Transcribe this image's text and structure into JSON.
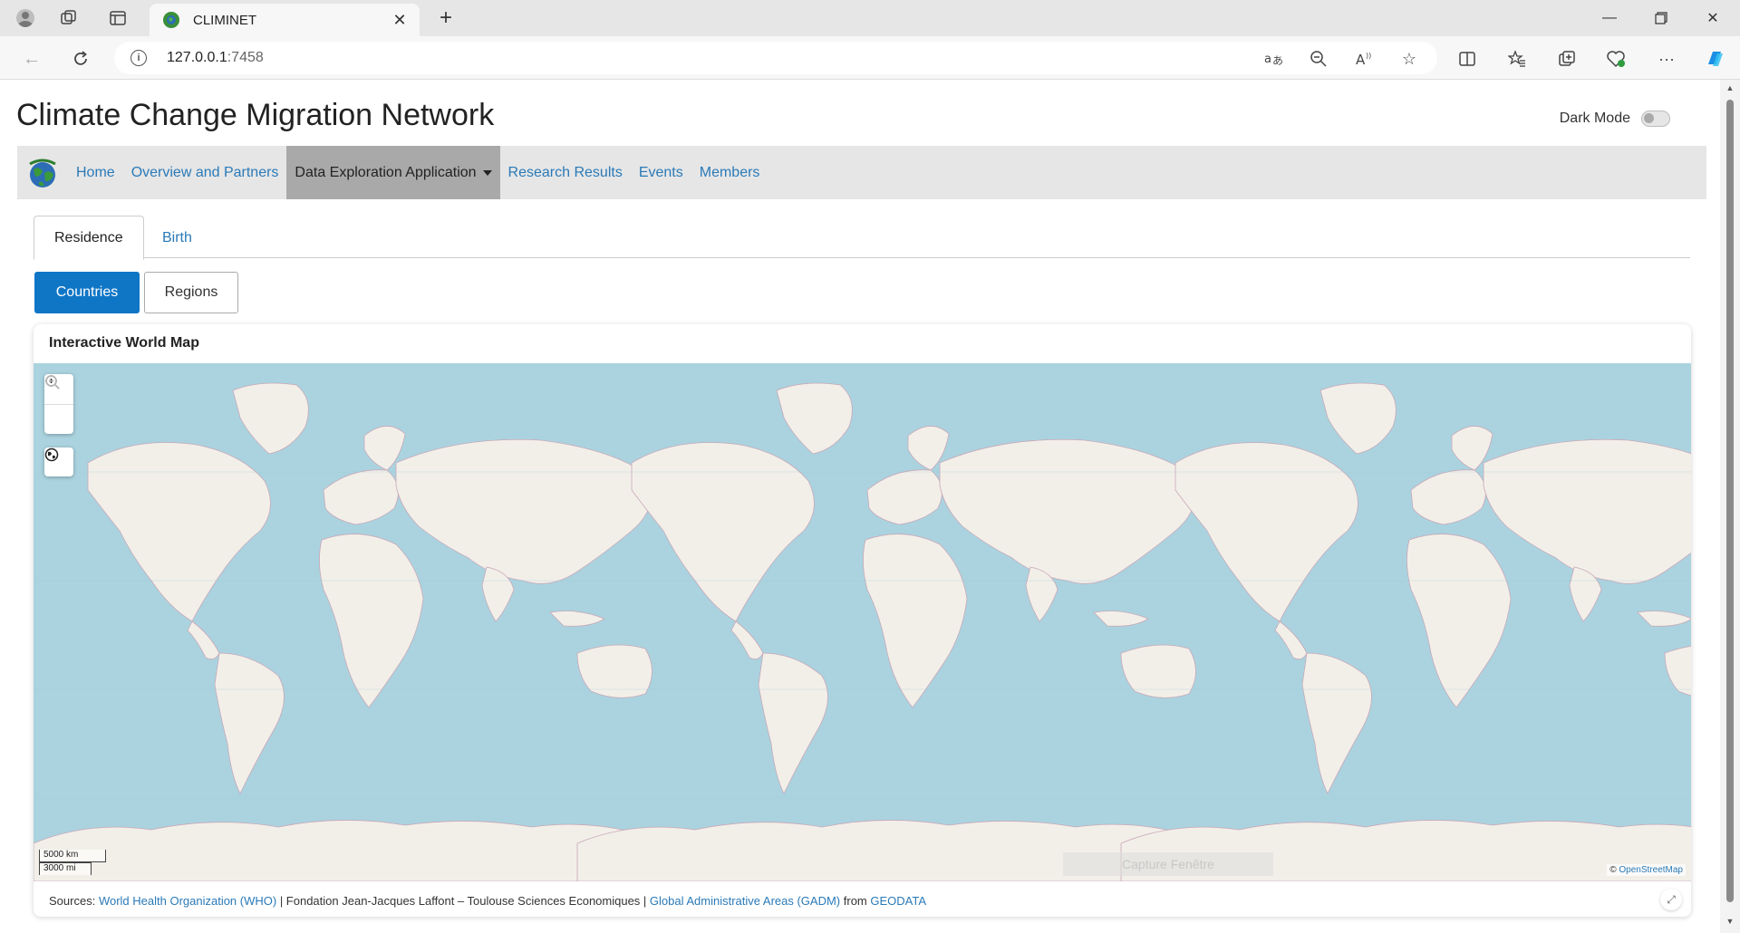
{
  "browser": {
    "tab_title": "CLIMINET",
    "url_host": "127.0.0.1",
    "url_port": ":7458"
  },
  "site": {
    "title": "Climate Change Migration Network",
    "dark_mode_label": "Dark Mode",
    "dark_mode_on": false
  },
  "navbar": {
    "items": [
      {
        "label": "Home"
      },
      {
        "label": "Overview and Partners"
      },
      {
        "label": "Data Exploration Application",
        "active": true
      },
      {
        "label": "Research Results"
      },
      {
        "label": "Events"
      },
      {
        "label": "Members"
      }
    ]
  },
  "tabs": {
    "residence": "Residence",
    "birth": "Birth"
  },
  "buttons": {
    "countries": "Countries",
    "regions": "Regions"
  },
  "map_card": {
    "title": "Interactive World Map",
    "scale_km": "5000 km",
    "scale_mi": "3000 mi",
    "attribution_prefix": "©",
    "attribution_link": "OpenStreetMap",
    "capture_overlay": "Capture Fenêtre"
  },
  "sources": {
    "label": "Sources:",
    "who": "World Health Organization (WHO)",
    "sep1": " | Fondation Jean-Jacques Laffont – Toulouse Sciences Economiques | ",
    "gadm": "Global Administrative Areas (GADM)",
    "from": " from ",
    "geodata": "GEODATA"
  },
  "colors": {
    "ocean": "#aad3df",
    "land": "#f2efe9",
    "primary": "#0f76c6",
    "link": "#2a7ab8"
  }
}
